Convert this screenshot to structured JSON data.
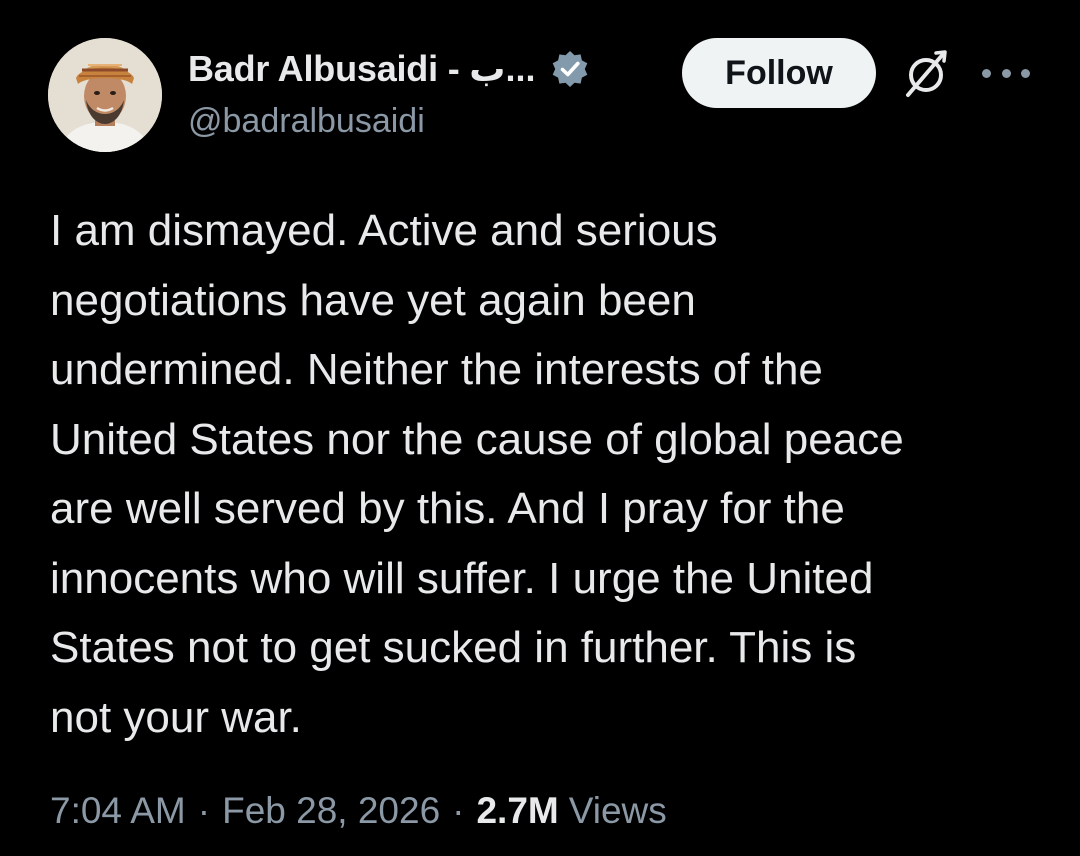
{
  "author": {
    "display_name": "Badr Albusaidi - ب...",
    "handle": "@badralbusaidi",
    "verified_icon": "verified-badge-icon",
    "verified_color": "#829aab"
  },
  "actions": {
    "follow_label": "Follow",
    "grok_icon": "grok-icon",
    "more_icon": "more-options-icon"
  },
  "tweet": {
    "text": "I am dismayed. Active and serious\nnegotiations have yet again been\nundermined. Neither the interests of the\nUnited States nor the cause of global peace\nare well served by this. And I pray for the\ninnocents who will suffer. I urge the United\nStates not to get sucked in further. This is\nnot your war.",
    "time": "7:04 AM",
    "separator": "·",
    "date": "Feb 28, 2026",
    "views_count": "2.7M",
    "views_label": "Views"
  },
  "colors": {
    "background": "#000000",
    "primary_text": "#e7e9ea",
    "secondary_text": "#8b98a5",
    "follow_bg": "#eff3f4"
  }
}
